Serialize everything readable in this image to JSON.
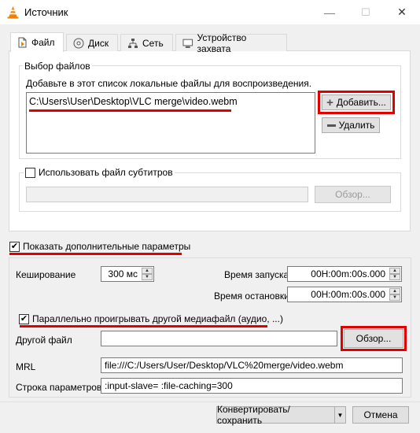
{
  "window": {
    "title": "Источник",
    "controls": {
      "minimize": "—",
      "maximize": "☐",
      "close": "✕"
    }
  },
  "tabs": [
    {
      "label": "Файл",
      "icon": "file-icon"
    },
    {
      "label": "Диск",
      "icon": "disc-icon"
    },
    {
      "label": "Сеть",
      "icon": "network-icon"
    },
    {
      "label": "Устройство захвата",
      "icon": "capture-device-icon"
    }
  ],
  "file_tab": {
    "group_title": "Выбор файлов",
    "description": "Добавьте в этот список локальные файлы для воспроизведения.",
    "files": [
      "C:\\Users\\User\\Desktop\\VLC merge\\video.webm"
    ],
    "add_button": "Добавить...",
    "remove_button": "Удалить",
    "subtitle_checkbox": "Использовать файл субтитров",
    "subtitle_browse": "Обзор..."
  },
  "advanced": {
    "show_checkbox": "Показать дополнительные параметры",
    "caching_label": "Кеширование",
    "caching_value": "300 мс",
    "start_label": "Время запуска",
    "start_value": "00H:00m:00s.000",
    "stop_label": "Время остановки",
    "stop_value": "00H:00m:00s.000",
    "parallel_checkbox": "Параллельно проигрывать другой медиафайл (аудио, ...)",
    "other_file_label": "Другой файл",
    "other_file_value": "",
    "other_file_browse": "Обзор...",
    "mrl_label": "MRL",
    "mrl_value": "file:///C:/Users/User/Desktop/VLC%20merge/video.webm",
    "options_label": "Строка параметров",
    "options_value": ":input-slave= :file-caching=300"
  },
  "footer": {
    "convert_button": "Конвертировать/сохранить",
    "cancel_button": "Отмена"
  },
  "colors": {
    "highlight": "#e00000",
    "vlc_orange": "#f08000"
  }
}
